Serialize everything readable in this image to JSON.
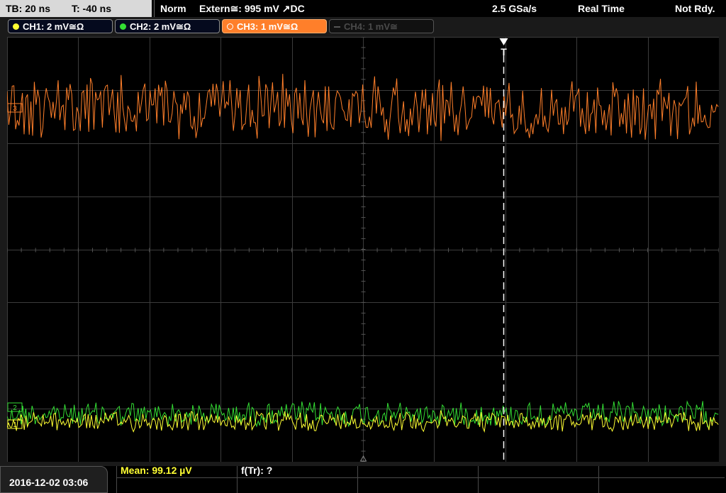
{
  "status_bar": {
    "timebase": "TB: 20 ns",
    "trigger_time": "T: -40 ns",
    "trigger_mode": "Norm",
    "trigger_source": "Extern≅: 995 mV ↗DC",
    "sample_rate": "2.5 GSa/s",
    "acquisition_mode": "Real Time",
    "run_state": "Not Rdy."
  },
  "channels": [
    {
      "label": "CH1: 2 mV≅Ω",
      "color": "#ffff33",
      "state": "on"
    },
    {
      "label": "CH2: 2 mV≅Ω",
      "color": "#33dd33",
      "state": "on"
    },
    {
      "label": "CH3: 1 mV≅Ω",
      "color": "#ff7f2a",
      "state": "active"
    },
    {
      "label": "CH4: 1 mV≅",
      "color": "#555555",
      "state": "off"
    }
  ],
  "channel_markers": {
    "ch1": "1",
    "ch2": "2",
    "ch3": "3"
  },
  "trigger_marker": "T",
  "measurements": {
    "mean": "Mean: 99.12 µV",
    "frequency": "f(Tr): ?"
  },
  "timestamp": "2016-12-02 03:06",
  "colors": {
    "grid": "#3c3c3c",
    "measurement_text": "#ffff33",
    "status_panel": "#d9d9d9"
  }
}
